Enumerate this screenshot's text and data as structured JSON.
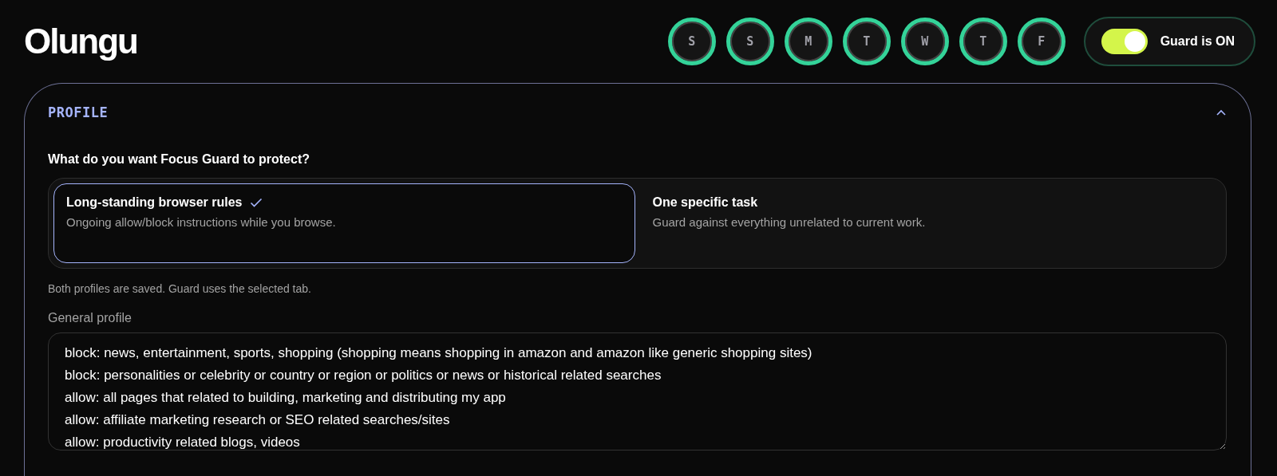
{
  "app": {
    "logo": "Olungu"
  },
  "days": [
    {
      "label": "S",
      "on": true
    },
    {
      "label": "S",
      "on": true
    },
    {
      "label": "M",
      "on": true
    },
    {
      "label": "T",
      "on": true
    },
    {
      "label": "W",
      "on": true
    },
    {
      "label": "T",
      "on": true
    },
    {
      "label": "F",
      "on": true
    }
  ],
  "guard": {
    "label": "Guard is ON",
    "on": true
  },
  "profile": {
    "title": "PROFILE",
    "expanded": true,
    "question": "What do you want Focus Guard to protect?",
    "tabs": [
      {
        "title": "Long-standing browser rules",
        "description": "Ongoing allow/block instructions while you browse.",
        "selected": true
      },
      {
        "title": "One specific task",
        "description": "Guard against everything unrelated to current work.",
        "selected": false
      }
    ],
    "note": "Both profiles are saved. Guard uses the selected tab.",
    "field_label": "General profile",
    "field_value": "block: news, entertainment, sports, shopping (shopping means shopping in amazon and amazon like generic shopping sites)\nblock: personalities or celebrity or country or region or politics or news or historical related searches\nallow: all pages that related to building, marketing and distributing my app\nallow: affiliate marketing research or SEO related searches/sites\nallow: productivity related blogs, videos"
  }
}
